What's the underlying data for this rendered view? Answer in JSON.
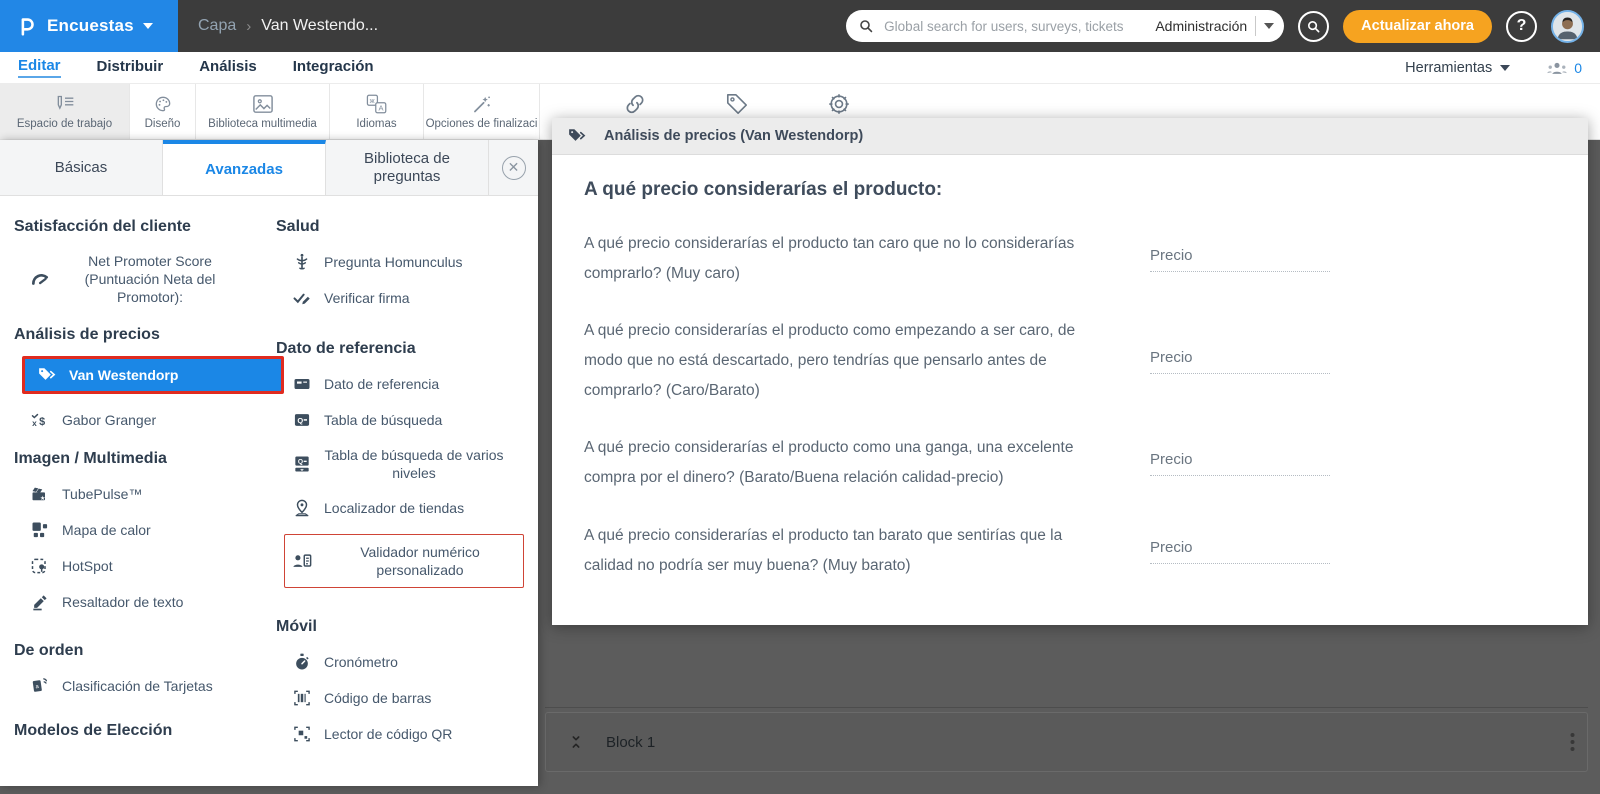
{
  "colors": {
    "accent_blue": "#1b87e6",
    "header_dark": "#3c3c3c",
    "logo_blue": "#2287e6",
    "update_orange": "#f6a320",
    "selected_border_red": "#e02b20",
    "backdrop_gray": "#5c5c5c"
  },
  "header": {
    "product_name": "Encuestas",
    "breadcrumb": {
      "parent": "Capa",
      "separator": "›",
      "current": "Van Westendo..."
    },
    "search": {
      "placeholder": "Global search for users, surveys, tickets",
      "scope": "Administración"
    },
    "update_button": "Actualizar ahora",
    "help_label": "?"
  },
  "menubar": {
    "items": [
      {
        "label": "Editar"
      },
      {
        "label": "Distribuir"
      },
      {
        "label": "Análisis"
      },
      {
        "label": "Integración"
      }
    ],
    "active": "Editar",
    "tools_label": "Herramientas",
    "collaborators_count": "0"
  },
  "toolstrip": {
    "tabs": [
      {
        "label": "Espacio de trabajo",
        "icon": "pen-list-icon",
        "active": true
      },
      {
        "label": "Diseño",
        "icon": "palette-icon"
      },
      {
        "label": "Biblioteca multimedia",
        "icon": "image-icon"
      },
      {
        "label": "Idiomas",
        "icon": "translate-icon"
      },
      {
        "label": "Opciones de finalizaci",
        "icon": "wand-icon"
      }
    ],
    "extra_icons": [
      "link-icon",
      "tag-icon",
      "gear-icon"
    ]
  },
  "sidebar": {
    "tabs": [
      {
        "label": "Básicas"
      },
      {
        "label": "Avanzadas",
        "active": true
      },
      {
        "label": "Biblioteca de preguntas"
      }
    ],
    "close_glyph": "✕",
    "col1": {
      "sections": [
        {
          "title": "Satisfacción del cliente",
          "items": [
            {
              "label": "Net Promoter Score (Puntuación Neta del Promotor):",
              "icon": "gauge-icon"
            }
          ]
        },
        {
          "title": "Análisis de precios",
          "items": [
            {
              "label": "Van Westendorp",
              "icon": "tag-icon",
              "selected": true
            },
            {
              "label": "Gabor Granger",
              "icon": "price-check-icon"
            }
          ]
        },
        {
          "title": "Imagen / Multimedia",
          "items": [
            {
              "label": "TubePulse™",
              "icon": "clapperboard-icon"
            },
            {
              "label": "Mapa de calor",
              "icon": "heatmap-icon"
            },
            {
              "label": "HotSpot",
              "icon": "hotspot-icon"
            },
            {
              "label": "Resaltador de texto",
              "icon": "highlighter-icon"
            }
          ]
        },
        {
          "title": "De orden",
          "items": [
            {
              "label": "Clasificación de Tarjetas",
              "icon": "cards-icon"
            }
          ]
        },
        {
          "title": "Modelos de Elección",
          "items": []
        }
      ]
    },
    "col2": {
      "sections": [
        {
          "title": "Salud",
          "items": [
            {
              "label": "Pregunta Homunculus",
              "icon": "caduceus-icon"
            },
            {
              "label": "Verificar firma",
              "icon": "signature-check-icon"
            }
          ]
        },
        {
          "title": "Dato de referencia",
          "items": [
            {
              "label": "Dato de referencia",
              "icon": "reference-card-icon"
            },
            {
              "label": "Tabla de búsqueda",
              "icon": "lookup-table-icon"
            },
            {
              "label": "Tabla de búsqueda de varios niveles",
              "icon": "multilevel-lookup-icon"
            },
            {
              "label": "Localizador de tiendas",
              "icon": "store-pin-icon"
            },
            {
              "label": "Validador numérico personalizado",
              "icon": "numeric-validator-icon",
              "outlined": true
            }
          ]
        },
        {
          "title": "Móvil",
          "items": [
            {
              "label": "Cronómetro",
              "icon": "stopwatch-icon"
            },
            {
              "label": "Código de barras",
              "icon": "barcode-icon"
            },
            {
              "label": "Lector de código QR",
              "icon": "qr-icon"
            }
          ]
        }
      ]
    }
  },
  "panel": {
    "header": "Análisis de precios (Van Westendorp)",
    "question_title": "A qué precio considerarías el producto:",
    "price_placeholder": "Precio",
    "questions": [
      {
        "text": "A qué precio considerarías el producto tan caro que no lo considerarías comprarlo? (Muy caro)"
      },
      {
        "text": "A qué precio considerarías el producto como empezando a ser caro, de modo que no está descartado, pero tendrías que pensarlo antes de comprarlo? (Caro/Barato)"
      },
      {
        "text": "A qué precio considerarías el producto como una ganga, una excelente compra por el dinero? (Barato/Buena relación calidad-precio)"
      },
      {
        "text": "A qué precio considerarías el producto tan barato que sentirías que la calidad no podría ser muy buena? (Muy barato)"
      }
    ]
  },
  "block_bar": {
    "label": "Block 1"
  }
}
